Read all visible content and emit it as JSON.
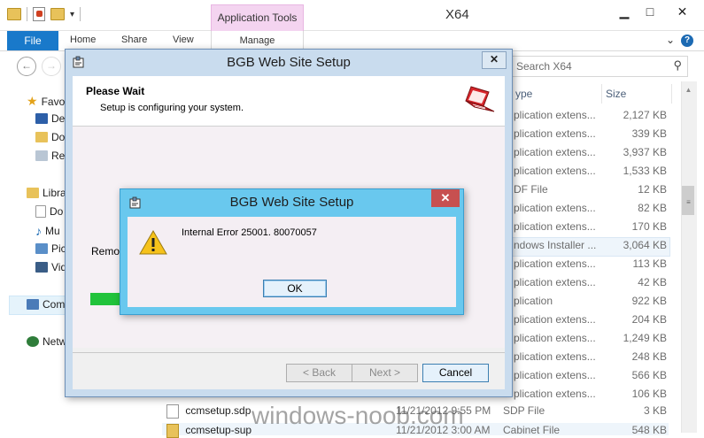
{
  "explorer": {
    "window_title": "X64",
    "contextual_group": "Application Tools",
    "ribbon_tabs": [
      "File",
      "Home",
      "Share",
      "View",
      "Manage"
    ],
    "search_placeholder": "Search X64",
    "columns": {
      "type": "ype",
      "size": "Size"
    },
    "nav_items": [
      "Favo",
      "De",
      "Do",
      "Re",
      "Libra",
      "Do",
      "Mu",
      "Pic",
      "Vid",
      "Com",
      "Netw"
    ],
    "rows": [
      {
        "type": "plication extens...",
        "size": "2,127 KB"
      },
      {
        "type": "plication extens...",
        "size": "339 KB"
      },
      {
        "type": "plication extens...",
        "size": "3,937 KB"
      },
      {
        "type": "plication extens...",
        "size": "1,533 KB"
      },
      {
        "type": "DF File",
        "size": "12 KB"
      },
      {
        "type": "plication extens...",
        "size": "82 KB"
      },
      {
        "type": "plication extens...",
        "size": "170 KB"
      },
      {
        "type": "ndows Installer ...",
        "size": "3,064 KB"
      },
      {
        "type": "plication extens...",
        "size": "113 KB"
      },
      {
        "type": "plication extens...",
        "size": "42 KB"
      },
      {
        "type": "plication",
        "size": "922 KB"
      },
      {
        "type": "plication extens...",
        "size": "204 KB"
      },
      {
        "type": "plication extens...",
        "size": "1,249 KB"
      },
      {
        "type": "plication extens...",
        "size": "248 KB"
      },
      {
        "type": "plication extens...",
        "size": "566 KB"
      },
      {
        "type": "plication extens...",
        "size": "106 KB"
      }
    ],
    "file_rows": [
      {
        "name": "ccmsetup.sdp",
        "date": "11/21/2012 9:55 PM",
        "type": "SDP File",
        "size": "3 KB"
      },
      {
        "name": "ccmsetup-sup",
        "date": "11/21/2012 3:00 AM",
        "type": "Cabinet File",
        "size": "548 KB"
      }
    ]
  },
  "wizard": {
    "title": "BGB Web Site Setup",
    "heading": "Please Wait",
    "subheading": "Setup is configuring your system.",
    "status": "Remov",
    "progress": 0.09,
    "back_label": "< Back",
    "next_label": "Next >",
    "cancel_label": "Cancel"
  },
  "error_dialog": {
    "title": "BGB Web Site Setup",
    "message": "Internal Error 25001. 80070057",
    "ok_label": "OK"
  },
  "watermark": "windows-noob.com"
}
